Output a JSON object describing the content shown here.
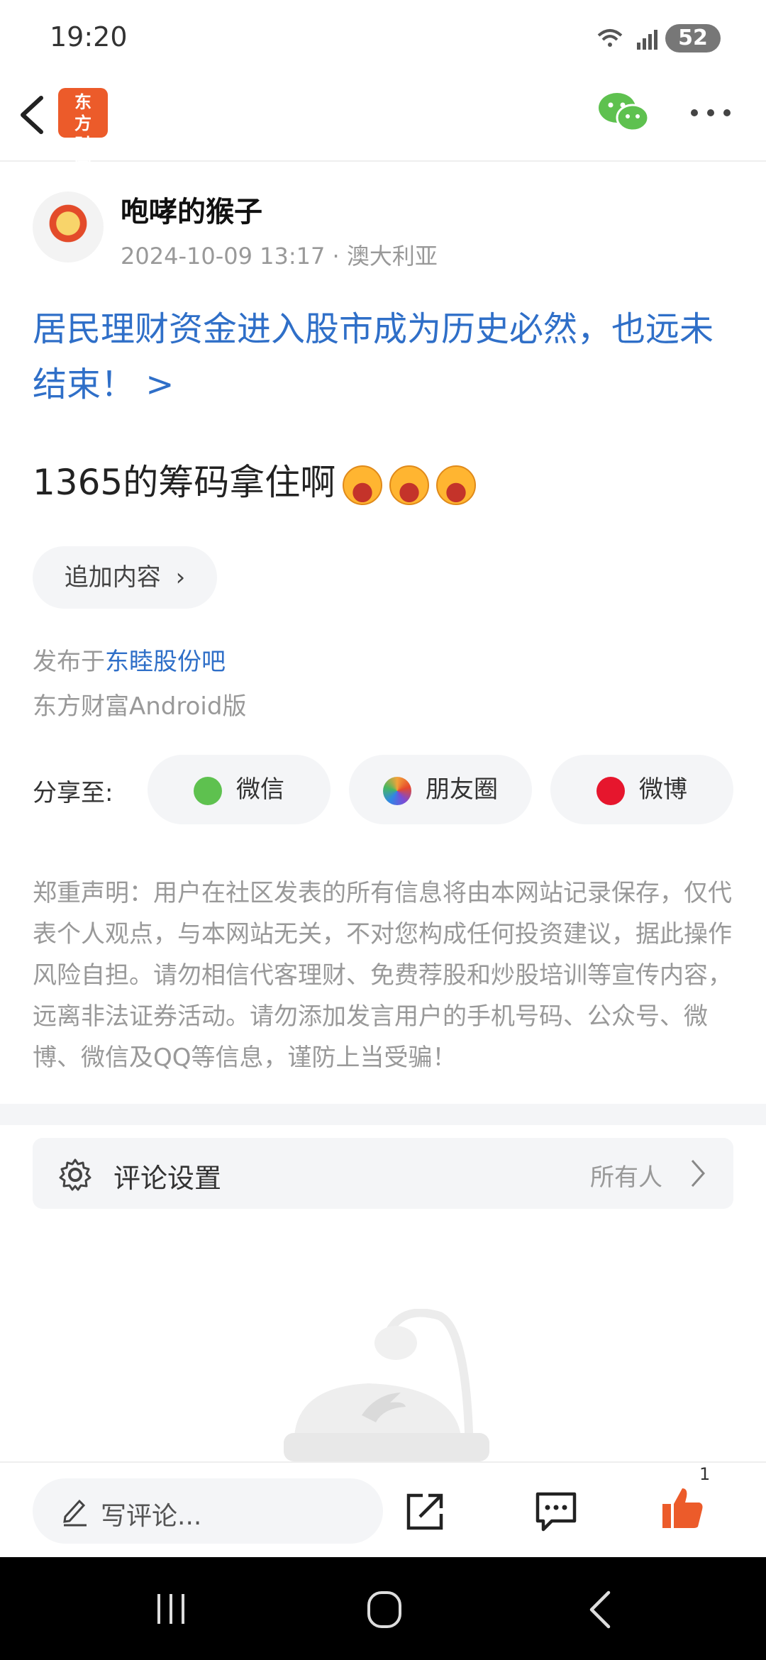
{
  "status_bar": {
    "time": "19:20",
    "battery": "52"
  },
  "nav": {
    "logo_text": "东方财富"
  },
  "post": {
    "author": "咆哮的猴子",
    "meta": "2024-10-09 13:17 · 澳大利亚",
    "title": "居民理财资金进入股市成为历史必然，也远未结束！ >",
    "body": "1365的筹码拿住啊",
    "add_content_label": "追加内容",
    "published_prefix": "发布于",
    "forum_link": "东睦股份吧",
    "platform": "东方财富Android版"
  },
  "share": {
    "label": "分享至:",
    "options": [
      {
        "label": "微信",
        "icon": "wechat-icon",
        "color": "#5ec14f"
      },
      {
        "label": "朋友圈",
        "icon": "moments-icon",
        "color": "#f2a33a"
      },
      {
        "label": "微博",
        "icon": "weibo-icon",
        "color": "#e6162d"
      }
    ]
  },
  "disclaimer": "郑重声明：用户在社区发表的所有信息将由本网站记录保存，仅代表个人观点，与本网站无关，不对您构成任何投资建议，据此操作风险自担。请勿相信代客理财、免费荐股和炒股培训等宣传内容，远离非法证券活动。请勿添加发言用户的手机号码、公众号、微博、微信及QQ等信息，谨防上当受骗！",
  "comment_settings": {
    "label": "评论设置",
    "value": "所有人"
  },
  "bottom_bar": {
    "comment_placeholder": "写评论...",
    "like_count": "1"
  },
  "colors": {
    "accent_blue": "#2f6fc8",
    "brand_orange": "#ec5b2a",
    "wechat_green": "#5ec14f"
  }
}
